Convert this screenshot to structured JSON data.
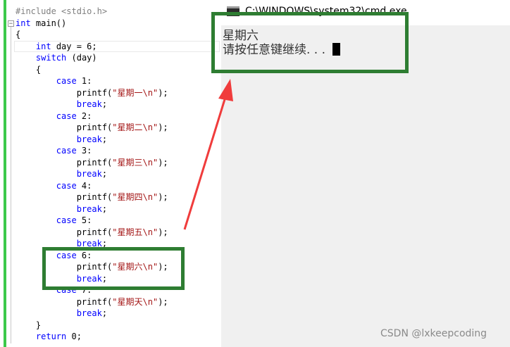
{
  "editor": {
    "lines": [
      {
        "parts": [
          {
            "t": "#include <stdio.h>",
            "c": "pp"
          }
        ]
      },
      {
        "parts": [
          {
            "t": "int",
            "c": "kw"
          },
          {
            "t": " main()",
            "c": ""
          }
        ]
      },
      {
        "parts": [
          {
            "t": "{",
            "c": ""
          }
        ]
      },
      {
        "parts": [
          {
            "t": "    ",
            "c": ""
          },
          {
            "t": "int",
            "c": "kw"
          },
          {
            "t": " day = 6;",
            "c": ""
          }
        ]
      },
      {
        "parts": [
          {
            "t": "    ",
            "c": ""
          },
          {
            "t": "switch",
            "c": "kw"
          },
          {
            "t": " (day)",
            "c": ""
          }
        ]
      },
      {
        "parts": [
          {
            "t": "    {",
            "c": ""
          }
        ]
      },
      {
        "parts": [
          {
            "t": "        ",
            "c": ""
          },
          {
            "t": "case",
            "c": "kw"
          },
          {
            "t": " 1:",
            "c": ""
          }
        ]
      },
      {
        "parts": [
          {
            "t": "            printf(",
            "c": ""
          },
          {
            "t": "\"星期一\\n\"",
            "c": "st"
          },
          {
            "t": ");",
            "c": ""
          }
        ]
      },
      {
        "parts": [
          {
            "t": "            ",
            "c": ""
          },
          {
            "t": "break",
            "c": "kw"
          },
          {
            "t": ";",
            "c": ""
          }
        ]
      },
      {
        "parts": [
          {
            "t": "        ",
            "c": ""
          },
          {
            "t": "case",
            "c": "kw"
          },
          {
            "t": " 2:",
            "c": ""
          }
        ]
      },
      {
        "parts": [
          {
            "t": "            printf(",
            "c": ""
          },
          {
            "t": "\"星期二\\n\"",
            "c": "st"
          },
          {
            "t": ");",
            "c": ""
          }
        ]
      },
      {
        "parts": [
          {
            "t": "            ",
            "c": ""
          },
          {
            "t": "break",
            "c": "kw"
          },
          {
            "t": ";",
            "c": ""
          }
        ]
      },
      {
        "parts": [
          {
            "t": "        ",
            "c": ""
          },
          {
            "t": "case",
            "c": "kw"
          },
          {
            "t": " 3:",
            "c": ""
          }
        ]
      },
      {
        "parts": [
          {
            "t": "            printf(",
            "c": ""
          },
          {
            "t": "\"星期三\\n\"",
            "c": "st"
          },
          {
            "t": ");",
            "c": ""
          }
        ]
      },
      {
        "parts": [
          {
            "t": "            ",
            "c": ""
          },
          {
            "t": "break",
            "c": "kw"
          },
          {
            "t": ";",
            "c": ""
          }
        ]
      },
      {
        "parts": [
          {
            "t": "        ",
            "c": ""
          },
          {
            "t": "case",
            "c": "kw"
          },
          {
            "t": " 4:",
            "c": ""
          }
        ]
      },
      {
        "parts": [
          {
            "t": "            printf(",
            "c": ""
          },
          {
            "t": "\"星期四\\n\"",
            "c": "st"
          },
          {
            "t": ");",
            "c": ""
          }
        ]
      },
      {
        "parts": [
          {
            "t": "            ",
            "c": ""
          },
          {
            "t": "break",
            "c": "kw"
          },
          {
            "t": ";",
            "c": ""
          }
        ]
      },
      {
        "parts": [
          {
            "t": "        ",
            "c": ""
          },
          {
            "t": "case",
            "c": "kw"
          },
          {
            "t": " 5:",
            "c": ""
          }
        ]
      },
      {
        "parts": [
          {
            "t": "            printf(",
            "c": ""
          },
          {
            "t": "\"星期五\\n\"",
            "c": "st"
          },
          {
            "t": ");",
            "c": ""
          }
        ]
      },
      {
        "parts": [
          {
            "t": "            ",
            "c": ""
          },
          {
            "t": "break",
            "c": "kw"
          },
          {
            "t": ";",
            "c": ""
          }
        ]
      },
      {
        "parts": [
          {
            "t": "        ",
            "c": ""
          },
          {
            "t": "case",
            "c": "kw"
          },
          {
            "t": " 6:",
            "c": ""
          }
        ]
      },
      {
        "parts": [
          {
            "t": "            printf(",
            "c": ""
          },
          {
            "t": "\"星期六\\n\"",
            "c": "st"
          },
          {
            "t": ");",
            "c": ""
          }
        ]
      },
      {
        "parts": [
          {
            "t": "            ",
            "c": ""
          },
          {
            "t": "break",
            "c": "kw"
          },
          {
            "t": ";",
            "c": ""
          }
        ]
      },
      {
        "parts": [
          {
            "t": "        ",
            "c": ""
          },
          {
            "t": "case",
            "c": "kw"
          },
          {
            "t": " 7:",
            "c": ""
          }
        ]
      },
      {
        "parts": [
          {
            "t": "            printf(",
            "c": ""
          },
          {
            "t": "\"星期天\\n\"",
            "c": "st"
          },
          {
            "t": ");",
            "c": ""
          }
        ]
      },
      {
        "parts": [
          {
            "t": "            ",
            "c": ""
          },
          {
            "t": "break",
            "c": "kw"
          },
          {
            "t": ";",
            "c": ""
          }
        ]
      },
      {
        "parts": [
          {
            "t": "    }",
            "c": ""
          }
        ]
      },
      {
        "parts": [
          {
            "t": "    ",
            "c": ""
          },
          {
            "t": "return",
            "c": "kw"
          },
          {
            "t": " 0;",
            "c": ""
          }
        ]
      }
    ],
    "fold_glyph": "−"
  },
  "console": {
    "title": "C:\\WINDOWS\\system32\\cmd.exe",
    "output_line1": "星期六",
    "output_line2": "请按任意键继续. . ."
  },
  "annotation": {
    "color": "#2e7d32",
    "arrow_color": "#f03c3c"
  },
  "watermark": "CSDN @lxkeepcoding"
}
